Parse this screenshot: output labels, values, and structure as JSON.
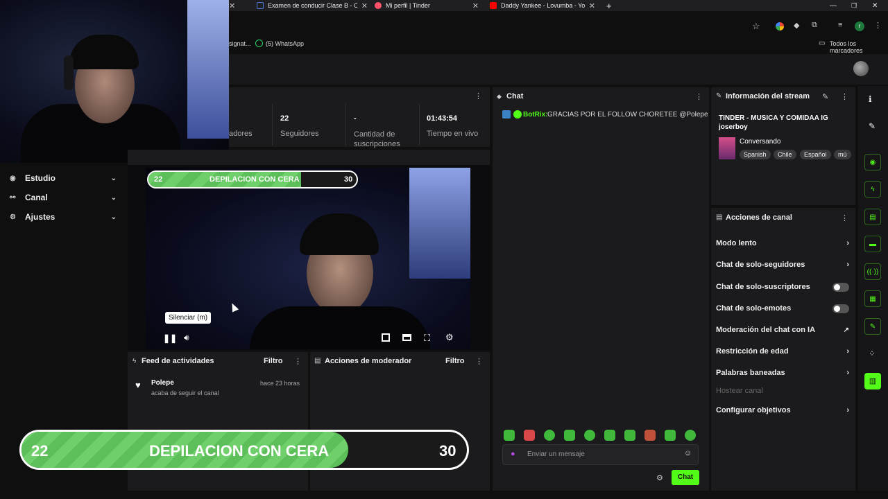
{
  "browser": {
    "tabs": [
      {
        "title": "Examen de conducir Clase B - Cor",
        "color": "#4a7bd6"
      },
      {
        "title": "Mi perfil | Tinder",
        "color": "#fd5068"
      },
      {
        "title": "Daddy Yankee - Lovumba - YouTu",
        "color": "#ff0000"
      }
    ],
    "bookmarks": {
      "left_fragment": "signat...",
      "whatsapp": "(5) WhatsApp",
      "all_bookmarks": "Todos los marcadores"
    }
  },
  "sidebar": {
    "items": [
      {
        "label": "Estudio",
        "icon": "studio-icon"
      },
      {
        "label": "Canal",
        "icon": "channel-icon"
      },
      {
        "label": "Ajustes",
        "icon": "settings-icon"
      }
    ]
  },
  "stats": {
    "followers_count_label_fragment": "adores",
    "followers": {
      "value": "22",
      "label": "Seguidores"
    },
    "subscriptions": {
      "value": "-",
      "label": "Cantidad de suscripciones"
    },
    "live_time": {
      "value": "01:43:54",
      "label": "Tiempo en vivo"
    }
  },
  "goal": {
    "current": "22",
    "title": "DEPILACION CON CERA",
    "target": "30",
    "progress_fraction": 0.733
  },
  "player": {
    "tooltip": "Silenciar (m)"
  },
  "activity_feed": {
    "title": "Feed de actividades",
    "filter": "Filtro",
    "items": [
      {
        "user": "Polepe",
        "time": "hace 23 horas",
        "text": "acaba de seguir el canal"
      }
    ]
  },
  "mod_actions": {
    "title": "Acciones de moderador",
    "filter": "Filtro"
  },
  "chat": {
    "title": "Chat",
    "messages": [
      {
        "user": "BotRix:",
        "text": "GRACIAS POR EL FOLLOW CHORETEE @Polepe"
      }
    ],
    "input_placeholder": "Enviar un mensaje",
    "send_label": "Chat",
    "accent": "#53fc18"
  },
  "stream_info": {
    "title": "Información del stream",
    "stream_title": "TINDER - MUSICA Y COMIDAA IG joserboy",
    "category": "Conversando",
    "tags": [
      "Spanish",
      "Chile",
      "Español",
      "mú"
    ]
  },
  "channel_actions": {
    "title": "Acciones de canal",
    "items": [
      {
        "label": "Modo lento",
        "control": "chevron"
      },
      {
        "label": "Chat de solo-seguidores",
        "control": "chevron"
      },
      {
        "label": "Chat de solo-suscriptores",
        "control": "toggle"
      },
      {
        "label": "Chat de solo-emotes",
        "control": "toggle"
      },
      {
        "label": "Moderación del chat con IA",
        "control": "external"
      },
      {
        "label": "Restricción de edad",
        "control": "chevron"
      },
      {
        "label": "Palabras baneadas",
        "control": "chevron"
      },
      {
        "label": "Hostear canal",
        "control": "none"
      },
      {
        "label": "Configurar objetivos",
        "control": "chevron"
      }
    ]
  }
}
